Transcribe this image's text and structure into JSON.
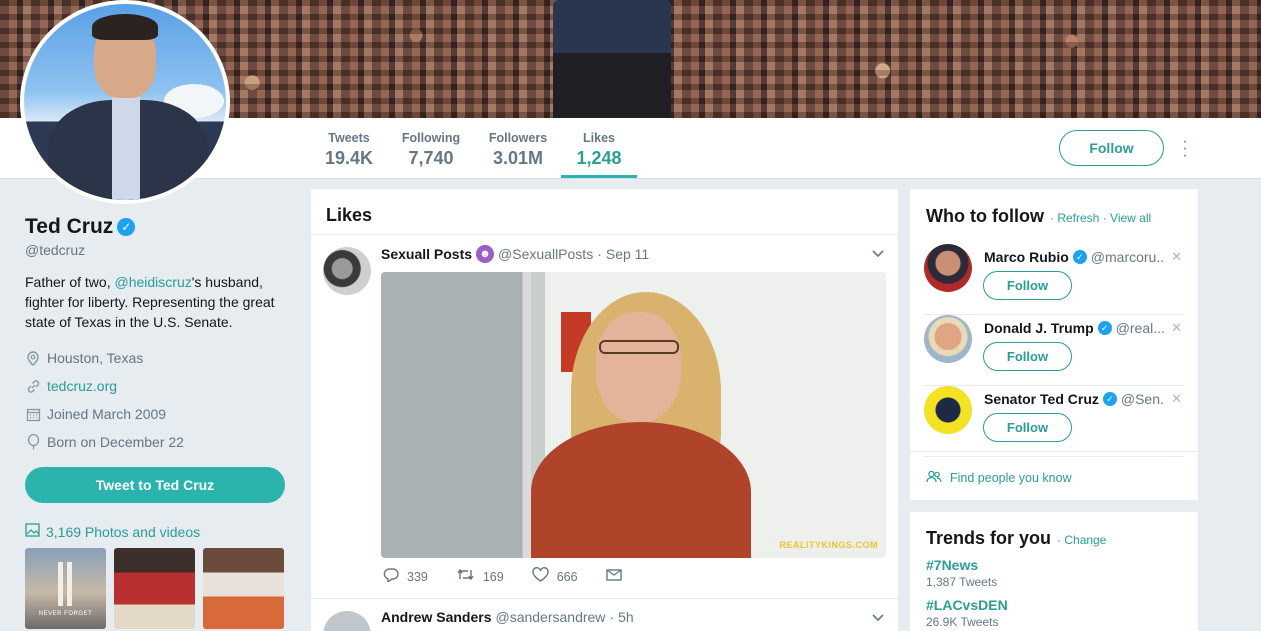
{
  "stats": [
    {
      "label": "Tweets",
      "value": "19.4K"
    },
    {
      "label": "Following",
      "value": "7,740"
    },
    {
      "label": "Followers",
      "value": "3.01M"
    },
    {
      "label": "Likes",
      "value": "1,248"
    }
  ],
  "header": {
    "follow_label": "Follow",
    "more_icon": "more-vertical-icon"
  },
  "profile": {
    "name": "Ted Cruz",
    "handle": "@tedcruz",
    "bio_prefix": "Father of two, ",
    "bio_mention": "@heidiscruz",
    "bio_suffix": "'s husband, fighter for liberty. Representing the great state of Texas in the U.S. Senate.",
    "location": "Houston, Texas",
    "website": "tedcruz.org",
    "joined": "Joined March 2009",
    "born": "Born on December 22",
    "tweet_to_label": "Tweet to Ted Cruz",
    "photos_label": "3,169 Photos and videos",
    "thumb1_caption": "NEVER FORGET"
  },
  "timeline": {
    "title": "Likes",
    "tweet1": {
      "name": "Sexuall Posts",
      "handle": "@SexuallPosts",
      "sep": "·",
      "time": "Sep 11",
      "watermark": "REALITYKINGS.COM",
      "replies": "339",
      "retweets": "169",
      "likes": "666"
    },
    "tweet2": {
      "name": "Andrew Sanders",
      "handle": "@sandersandrew",
      "sep": "·",
      "time": "5h"
    }
  },
  "who_to_follow": {
    "title": "Who to follow",
    "refresh": "Refresh",
    "view_all": "View all",
    "sep": "·",
    "suggestions": [
      {
        "name": "Marco Rubio",
        "handle": "@marcoru...",
        "follow": "Follow"
      },
      {
        "name": "Donald J. Trump",
        "handle": "@real...",
        "follow": "Follow"
      },
      {
        "name": "Senator Ted Cruz",
        "handle": "@Sen...",
        "follow": "Follow"
      }
    ],
    "find_people": "Find people you know"
  },
  "trends": {
    "title": "Trends for you",
    "change": "Change",
    "items": [
      {
        "name": "#7News",
        "count": "1,387 Tweets"
      },
      {
        "name": "#LACvsDEN",
        "count": "26.9K Tweets"
      }
    ]
  },
  "colors": {
    "accent": "#2a9d97",
    "verified": "#1da1f2",
    "background": "#e6ecf0"
  }
}
